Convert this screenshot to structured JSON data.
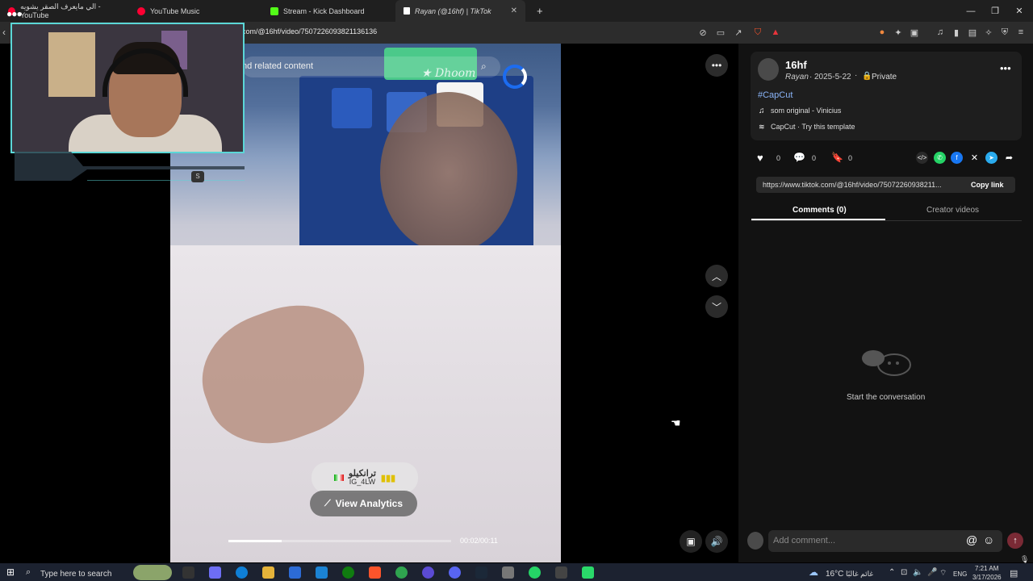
{
  "browser": {
    "tabs": [
      {
        "label": "الي مايعرف الصقر يشويه - YouTube",
        "active": false,
        "color": "#ff0033"
      },
      {
        "label": "YouTube Music",
        "active": false,
        "color": "#ff0033"
      },
      {
        "label": "Stream - Kick Dashboard",
        "active": false,
        "color": "#53fc18"
      },
      {
        "label": "Rayan (@16hf) | TikTok",
        "active": true,
        "color": "#ffffff"
      }
    ],
    "new_tab": "+",
    "url": "com/@16hf/video/7507226093821136136"
  },
  "video": {
    "search_overlay": "nd related content",
    "watermark": "★ Dhoom",
    "music_tag_text": "ترانكيلو",
    "music_tag_sub": "IG_4LW",
    "analytics_label": "View Analytics",
    "progress": 0.24,
    "time": "00:02/00:11"
  },
  "webcam": {
    "badge": "S"
  },
  "post": {
    "username": "16hf",
    "display_name": "Rayan",
    "date": "2025-5-22",
    "privacy": "Private",
    "hashtag": "#CapCut",
    "sound": "som original - Vinicius",
    "template": "CapCut · Try this template",
    "likes": "0",
    "comments": "0",
    "saves": "0",
    "link": "https://www.tiktok.com/@16hf/video/75072260938211...",
    "copy_link": "Copy link",
    "tab_comments": "Comments (0)",
    "tab_creator": "Creator videos",
    "empty_state": "Start the conversation",
    "comment_placeholder": "Add comment..."
  },
  "taskbar": {
    "search": "Type here to search",
    "weather": "16°C",
    "weather_desc": "غائم غالبًا",
    "lang": "ENG",
    "time": "7:21 AM",
    "date": "3/17/2026"
  },
  "colors": {
    "accent": "#fe2c55",
    "link": "#8ab4f8",
    "cam_border": "#5bd7d7"
  }
}
